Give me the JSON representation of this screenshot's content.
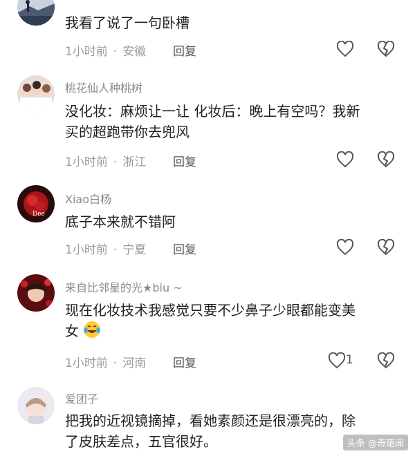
{
  "comments": [
    {
      "username": "",
      "content": "我看了说了一句卧槽",
      "time": "1小时前",
      "location": "安徽",
      "reply_label": "回复",
      "avatar_icon": "landscape-avatar-icon",
      "like_count": ""
    },
    {
      "username": "桃花仙人种桃树",
      "content_line1": "没化妆：麻烦让一让  化妆后：晚上有空吗？我新",
      "content_line2": "买的超跑带你去兜风",
      "time": "1小时前",
      "location": "浙江",
      "reply_label": "回复",
      "avatar_icon": "group-photo-avatar-icon",
      "like_count": ""
    },
    {
      "username": "Xiao白杨",
      "content": "底子本来就不错阿",
      "time": "1小时前",
      "location": "宁夏",
      "reply_label": "回复",
      "avatar_icon": "red-flower-avatar-icon",
      "like_count": ""
    },
    {
      "username": "来自比邻星的光★biu ~",
      "content_line1": "现在化妆技术我感觉只要不少鼻子少眼都能变美",
      "content_line2": "女",
      "emoji": "laughing-tears-emoji-icon",
      "time": "1小时前",
      "location": "河南",
      "reply_label": "回复",
      "avatar_icon": "red-portrait-avatar-icon",
      "like_count": "1"
    },
    {
      "username": "爱团子",
      "content_line1": "把我的近视镜摘掉，看她素颜还是很漂亮的，除",
      "content_line2": "了皮肤差点，五官很好。",
      "avatar_icon": "portrait-avatar-icon"
    }
  ],
  "separator": "·",
  "watermark": "头条 @奇葩闻",
  "colors": {
    "text": "#222222",
    "meta": "#9a9a9a",
    "icon": "#555555"
  }
}
